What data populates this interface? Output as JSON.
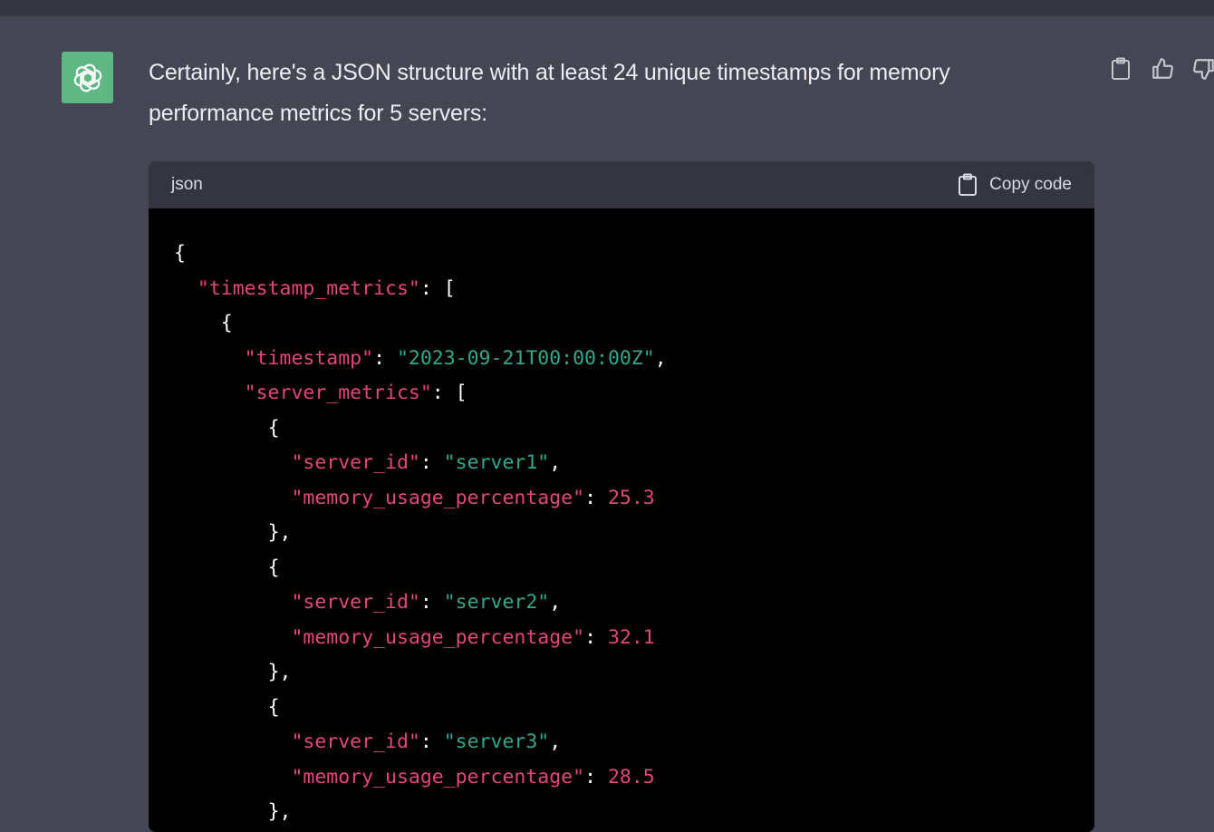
{
  "message": {
    "line1": "Certainly, here's a JSON structure with at least 24 unique timestamps for memory",
    "line2": "performance metrics for 5 servers:"
  },
  "assistant_avatar_icon": "openai-logo-icon",
  "actions": {
    "copy_icon": "clipboard-icon",
    "like_icon": "thumbs-up-icon",
    "dislike_icon": "thumbs-down-icon"
  },
  "code_block": {
    "language": "json",
    "copy_label": "Copy code",
    "lines": [
      {
        "indent": "",
        "parts": [
          {
            "t": "{",
            "c": "punc"
          }
        ]
      },
      {
        "indent": "  ",
        "parts": [
          {
            "t": "\"timestamp_metrics\"",
            "c": "key"
          },
          {
            "t": ": [",
            "c": "punc"
          }
        ]
      },
      {
        "indent": "    ",
        "parts": [
          {
            "t": "{",
            "c": "punc"
          }
        ]
      },
      {
        "indent": "      ",
        "parts": [
          {
            "t": "\"timestamp\"",
            "c": "key"
          },
          {
            "t": ": ",
            "c": "punc"
          },
          {
            "t": "\"2023-09-21T00:00:00Z\"",
            "c": "str"
          },
          {
            "t": ",",
            "c": "punc"
          }
        ]
      },
      {
        "indent": "      ",
        "parts": [
          {
            "t": "\"server_metrics\"",
            "c": "key"
          },
          {
            "t": ": [",
            "c": "punc"
          }
        ]
      },
      {
        "indent": "        ",
        "parts": [
          {
            "t": "{",
            "c": "punc"
          }
        ]
      },
      {
        "indent": "          ",
        "parts": [
          {
            "t": "\"server_id\"",
            "c": "key"
          },
          {
            "t": ": ",
            "c": "punc"
          },
          {
            "t": "\"server1\"",
            "c": "str"
          },
          {
            "t": ",",
            "c": "punc"
          }
        ]
      },
      {
        "indent": "          ",
        "parts": [
          {
            "t": "\"memory_usage_percentage\"",
            "c": "key"
          },
          {
            "t": ": ",
            "c": "punc"
          },
          {
            "t": "25.3",
            "c": "num"
          }
        ]
      },
      {
        "indent": "        ",
        "parts": [
          {
            "t": "},",
            "c": "punc"
          }
        ]
      },
      {
        "indent": "        ",
        "parts": [
          {
            "t": "{",
            "c": "punc"
          }
        ]
      },
      {
        "indent": "          ",
        "parts": [
          {
            "t": "\"server_id\"",
            "c": "key"
          },
          {
            "t": ": ",
            "c": "punc"
          },
          {
            "t": "\"server2\"",
            "c": "str"
          },
          {
            "t": ",",
            "c": "punc"
          }
        ]
      },
      {
        "indent": "          ",
        "parts": [
          {
            "t": "\"memory_usage_percentage\"",
            "c": "key"
          },
          {
            "t": ": ",
            "c": "punc"
          },
          {
            "t": "32.1",
            "c": "num"
          }
        ]
      },
      {
        "indent": "        ",
        "parts": [
          {
            "t": "},",
            "c": "punc"
          }
        ]
      },
      {
        "indent": "        ",
        "parts": [
          {
            "t": "{",
            "c": "punc"
          }
        ]
      },
      {
        "indent": "          ",
        "parts": [
          {
            "t": "\"server_id\"",
            "c": "key"
          },
          {
            "t": ": ",
            "c": "punc"
          },
          {
            "t": "\"server3\"",
            "c": "str"
          },
          {
            "t": ",",
            "c": "punc"
          }
        ]
      },
      {
        "indent": "          ",
        "parts": [
          {
            "t": "\"memory_usage_percentage\"",
            "c": "key"
          },
          {
            "t": ": ",
            "c": "punc"
          },
          {
            "t": "28.5",
            "c": "num"
          }
        ]
      },
      {
        "indent": "        ",
        "parts": [
          {
            "t": "},",
            "c": "punc"
          }
        ]
      }
    ]
  },
  "colors": {
    "background": "#444654",
    "avatar": "#5fb884",
    "key": "#e2467e",
    "string": "#2fa88d",
    "number": "#e2467e"
  }
}
